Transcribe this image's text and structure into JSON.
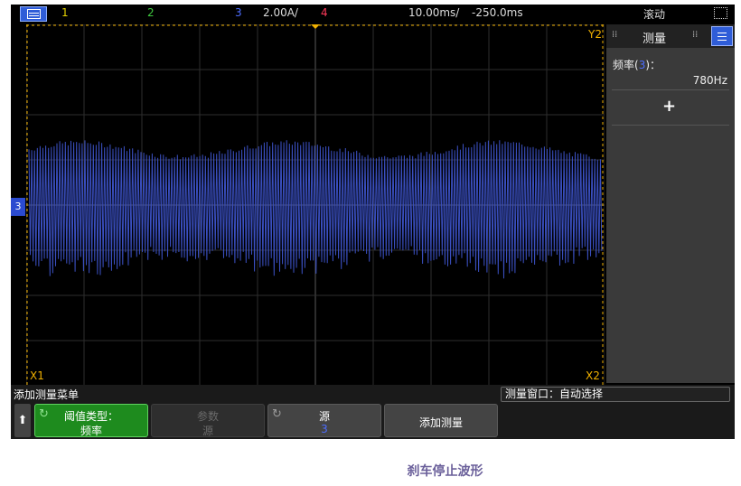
{
  "topbar": {
    "ch1": "1",
    "ch2": "2",
    "ch3": "3",
    "ch3_scale": "2.00A/",
    "ch4": "4",
    "timebase": "10.00ms/",
    "delay": "-250.0ms",
    "mode": "滚动"
  },
  "colors": {
    "ch1": "#e6d200",
    "ch2": "#3fc93f",
    "ch3": "#4d6dff",
    "ch4": "#ff3a5a",
    "cursor": "#f0b000",
    "waveform": "#3a4fc0"
  },
  "markers": {
    "ch3_ground": "3",
    "x1": "X1",
    "x2": "X2",
    "y2": "Y2"
  },
  "panel": {
    "title": "测量",
    "meas_label": "频率",
    "meas_source": "3",
    "meas_value": "780Hz",
    "add_icon": "plus-icon"
  },
  "bottom": {
    "menu_title": "添加测量菜单",
    "meas_window": "测量窗口：自动选择",
    "softkeys": {
      "threshold_l1": "阈值类型：",
      "threshold_l2": "频率",
      "params_l1": "参数",
      "params_l2": "源",
      "source_l1": "源",
      "source_l2": "3",
      "add_measure": "添加测量"
    }
  },
  "caption": "刹车停止波形"
}
